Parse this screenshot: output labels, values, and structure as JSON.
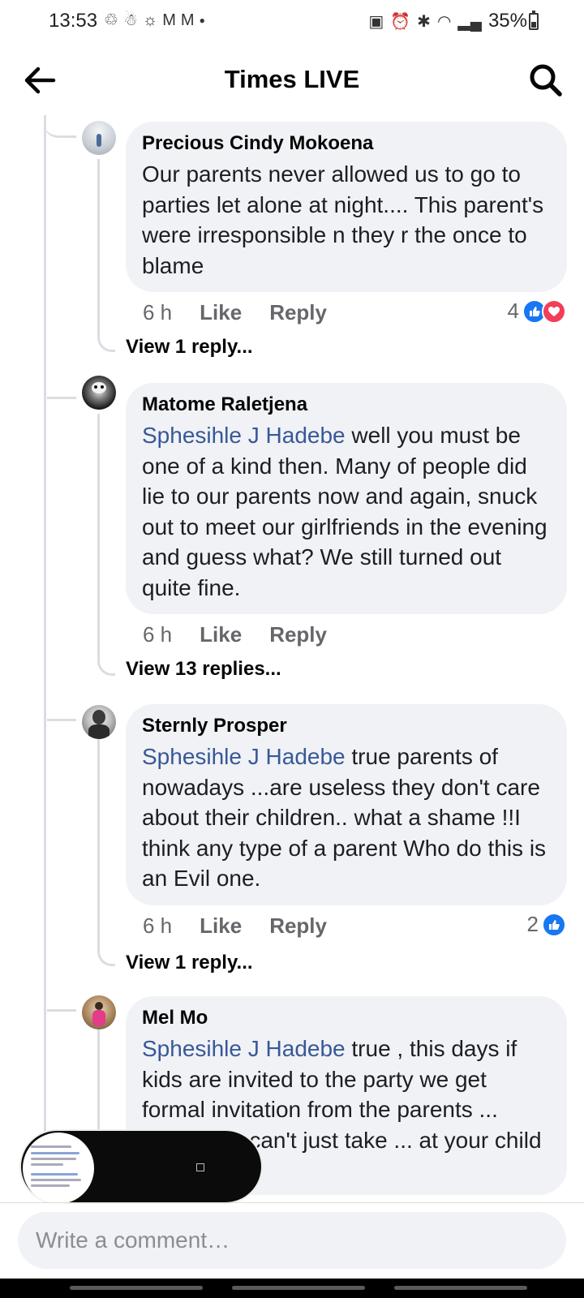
{
  "status_bar": {
    "time": "13:53",
    "battery": "35%"
  },
  "app_bar": {
    "title": "Times LIVE"
  },
  "comments": [
    {
      "author": "Precious Cindy Mokoena",
      "mention": "",
      "text": "Our parents never allowed us to go to parties let alone at night.... This parent's were irresponsible n they r the once to blame",
      "time": "6 h",
      "like": "Like",
      "reply": "Reply",
      "reaction_count": "4",
      "reactions": [
        "like",
        "love"
      ],
      "view_replies": "View 1 reply..."
    },
    {
      "author": "Matome Raletjena",
      "mention": "Sphesihle J Hadebe",
      "text": " well you must be one of a kind then. Many of people did lie to our parents now and again, snuck out to meet our girlfriends in the evening and guess what? We still turned out quite fine.",
      "time": "6 h",
      "like": "Like",
      "reply": "Reply",
      "reaction_count": "",
      "reactions": [],
      "view_replies": "View 13 replies..."
    },
    {
      "author": "Sternly Prosper",
      "mention": "Sphesihle J Hadebe",
      "text": " true parents of nowadays ...are useless they don't care about their children.. what a shame !!I think any type of a parent Who do this is an Evil one.",
      "time": "6 h",
      "like": "Like",
      "reply": "Reply",
      "reaction_count": "2",
      "reactions": [
        "like"
      ],
      "view_replies": "View 1 reply..."
    },
    {
      "author": "Mel Mo",
      "mention": "Sphesihle J Hadebe",
      "text": " true , this days if kids are invited to the party we get formal invitation from the parents ... them. You can't just take ... at your child say"
    }
  ],
  "comment_box": {
    "placeholder": "Write a comment…"
  },
  "colors": {
    "mention": "#385898",
    "like": "#1877f2",
    "love": "#f33e58",
    "bubble": "#f0f2f5"
  }
}
